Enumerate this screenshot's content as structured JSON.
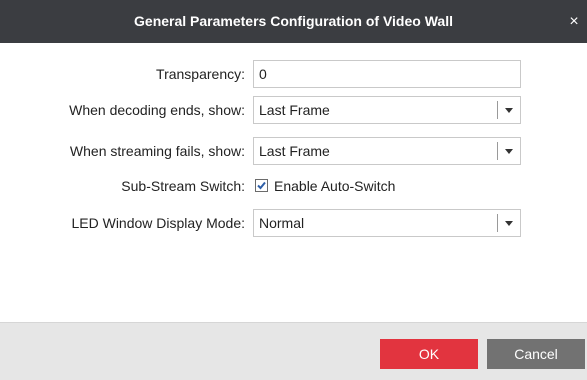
{
  "dialog": {
    "title": "General Parameters Configuration of Video Wall",
    "close_glyph": "×"
  },
  "fields": {
    "transparency": {
      "label": "Transparency:",
      "value": "0"
    },
    "decoding_ends": {
      "label": "When decoding ends, show:",
      "value": "Last Frame"
    },
    "streaming_fails": {
      "label": "When streaming fails, show:",
      "value": "Last Frame"
    },
    "sub_stream": {
      "label": "Sub-Stream Switch:",
      "checkbox_label": "Enable Auto-Switch",
      "checked": true
    },
    "led_mode": {
      "label": "LED Window Display Mode:",
      "value": "Normal"
    }
  },
  "buttons": {
    "ok": "OK",
    "cancel": "Cancel"
  },
  "colors": {
    "titlebar": "#3b3d41",
    "ok_button": "#e2343f",
    "cancel_button": "#727272",
    "footer": "#e6e6e6"
  }
}
